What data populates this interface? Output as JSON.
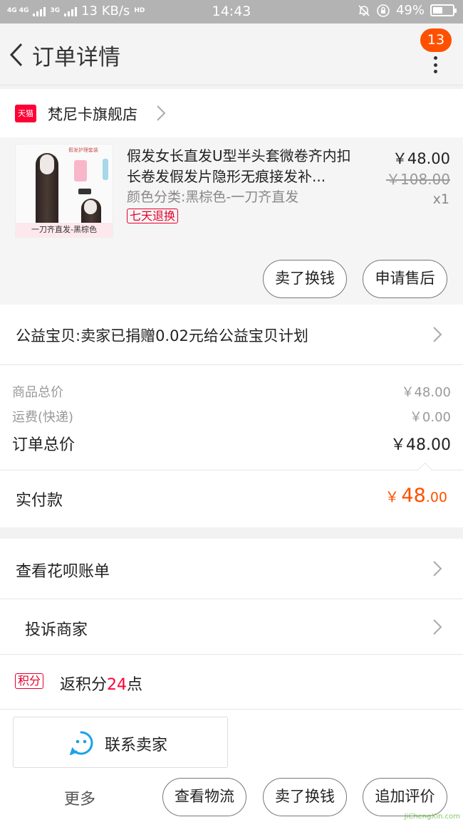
{
  "status_bar": {
    "network_1": "4G 4G",
    "network_2": "3G",
    "speed": "13 KB/s",
    "hd": "HD",
    "time": "14:43",
    "battery": "49%",
    "battery_level": 0.49
  },
  "nav": {
    "title": "订单详情",
    "badge_count": "13"
  },
  "store": {
    "badge": "天猫",
    "name": "梵尼卡旗舰店"
  },
  "product": {
    "title": "假发女长直发U型半头套微卷齐内扣长卷发假发片隐形无痕接发补...",
    "variant": "颜色分类:黑棕色-一刀齐直发",
    "return_tag": "七天退换",
    "price": "￥48.00",
    "original_price": "￥108.00",
    "quantity": "x1",
    "image_caption": "一刀齐直发-黑棕色",
    "image_accessory_label": "假发护理套装",
    "actions": {
      "resell": "卖了换钱",
      "after_sale": "申请售后"
    }
  },
  "charity": {
    "text": "公益宝贝:卖家已捐赠0.02元给公益宝贝计划"
  },
  "totals": {
    "goods_label": "商品总价",
    "goods_value": "￥48.00",
    "shipping_label": "运费(快递)",
    "shipping_value": "￥0.00",
    "order_label": "订单总价",
    "order_value": "￥48.00"
  },
  "paid": {
    "label": "实付款",
    "currency": "￥",
    "integer": "48",
    "decimal": ".00"
  },
  "menu": {
    "huabei": "查看花呗账单",
    "complain": "投诉商家",
    "points_tag": "积分",
    "points_prefix": "返积分",
    "points_value": "24",
    "points_suffix": "点"
  },
  "bottom": {
    "contact_seller": "联系卖家",
    "more": "更多",
    "logistics": "查看物流",
    "resell": "卖了换钱",
    "review": "追加评价"
  },
  "watermark": "JiChengXin.com",
  "colors": {
    "accent": "#ff5000",
    "tmall_red": "#ff0036",
    "contact_blue": "#1aa1e8"
  }
}
